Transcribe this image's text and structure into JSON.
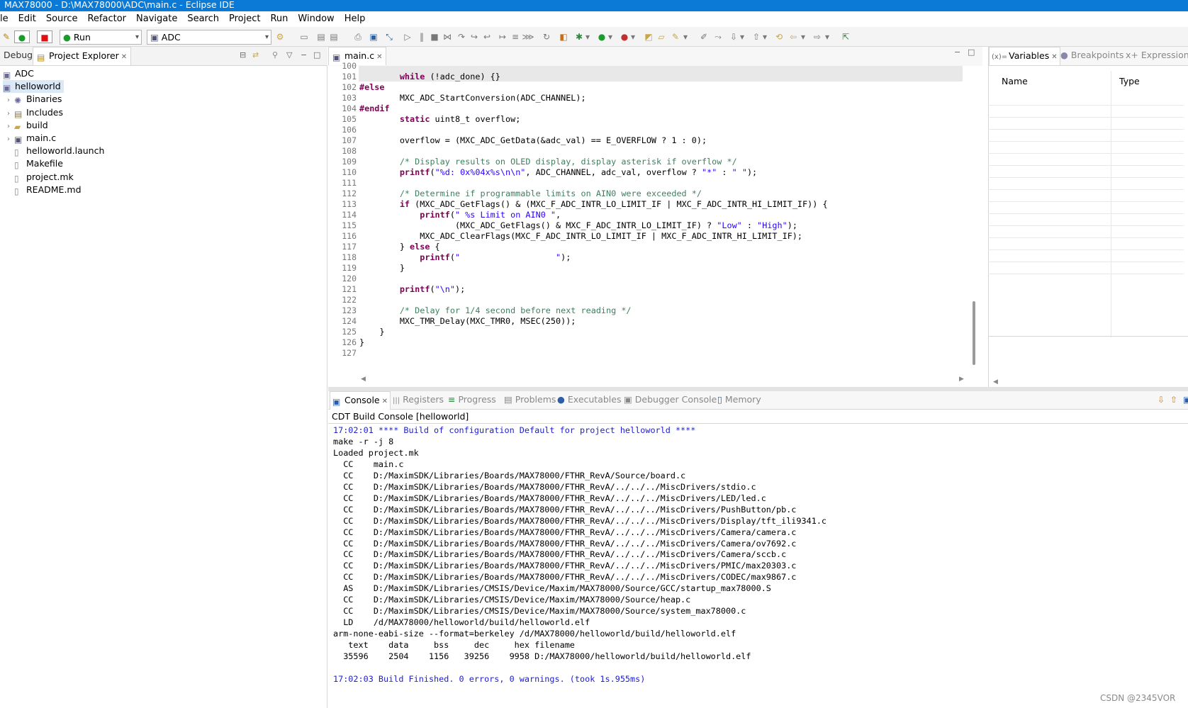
{
  "window": {
    "title": "MAX78000 - D:\\MAX78000\\ADC\\main.c - Eclipse IDE"
  },
  "menu": [
    "le",
    "Edit",
    "Source",
    "Refactor",
    "Navigate",
    "Search",
    "Project",
    "Run",
    "Window",
    "Help"
  ],
  "toolbar": {
    "run_config": "Run",
    "project_combo": "ADC"
  },
  "left_panel": {
    "tabs": [
      "Debug",
      "Project Explorer"
    ],
    "tree": [
      {
        "label": "ADC",
        "depth": 0,
        "expandable": false,
        "selected": false,
        "icon": "project-icon"
      },
      {
        "label": "helloworld",
        "depth": 0,
        "expandable": false,
        "selected": true,
        "icon": "project-icon"
      },
      {
        "label": "Binaries",
        "depth": 1,
        "expandable": true,
        "selected": false,
        "icon": "binaries-icon"
      },
      {
        "label": "Includes",
        "depth": 1,
        "expandable": true,
        "selected": false,
        "icon": "includes-icon"
      },
      {
        "label": "build",
        "depth": 1,
        "expandable": true,
        "selected": false,
        "icon": "folder-icon"
      },
      {
        "label": "main.c",
        "depth": 1,
        "expandable": true,
        "selected": false,
        "icon": "c-file-icon"
      },
      {
        "label": "helloworld.launch",
        "depth": 1,
        "expandable": false,
        "selected": false,
        "icon": "file-icon"
      },
      {
        "label": "Makefile",
        "depth": 1,
        "expandable": false,
        "selected": false,
        "icon": "file-icon"
      },
      {
        "label": "project.mk",
        "depth": 1,
        "expandable": false,
        "selected": false,
        "icon": "file-icon"
      },
      {
        "label": "README.md",
        "depth": 1,
        "expandable": false,
        "selected": false,
        "icon": "file-icon"
      }
    ]
  },
  "editor": {
    "tab": "main.c",
    "lines": [
      {
        "n": "100",
        "t": []
      },
      {
        "n": "101",
        "t": [
          [
            "",
            "        "
          ],
          [
            "kw",
            "while"
          ],
          [
            "",
            " (!adc_done) {}"
          ]
        ],
        "hl": true
      },
      {
        "n": "102",
        "t": [
          [
            "pp",
            "#else"
          ]
        ]
      },
      {
        "n": "103",
        "t": [
          [
            "",
            "        MXC_ADC_StartConversion(ADC_CHANNEL);"
          ]
        ]
      },
      {
        "n": "104",
        "t": [
          [
            "pp",
            "#endif"
          ]
        ]
      },
      {
        "n": "105",
        "t": [
          [
            "",
            "        "
          ],
          [
            "kw",
            "static"
          ],
          [
            "",
            " uint8_t overflow;"
          ]
        ]
      },
      {
        "n": "106",
        "t": []
      },
      {
        "n": "107",
        "t": [
          [
            "",
            "        overflow = (MXC_ADC_GetData(&adc_val) == E_OVERFLOW ? 1 : 0);"
          ]
        ]
      },
      {
        "n": "108",
        "t": []
      },
      {
        "n": "109",
        "t": [
          [
            "",
            "        "
          ],
          [
            "cm",
            "/* Display results on OLED display, display asterisk if overflow */"
          ]
        ]
      },
      {
        "n": "110",
        "t": [
          [
            "",
            "        "
          ],
          [
            "kw",
            "printf"
          ],
          [
            "",
            "("
          ],
          [
            "st",
            "\"%d: 0x%04x%s\\n\\n\""
          ],
          [
            "",
            ", ADC_CHANNEL, adc_val, overflow ? "
          ],
          [
            "st",
            "\"*\""
          ],
          [
            "",
            " : "
          ],
          [
            "st",
            "\" \""
          ],
          [
            "",
            ");"
          ]
        ]
      },
      {
        "n": "111",
        "t": []
      },
      {
        "n": "112",
        "t": [
          [
            "",
            "        "
          ],
          [
            "cm",
            "/* Determine if programmable limits on AIN0 were exceeded */"
          ]
        ]
      },
      {
        "n": "113",
        "t": [
          [
            "",
            "        "
          ],
          [
            "kw",
            "if"
          ],
          [
            "",
            " (MXC_ADC_GetFlags() & (MXC_F_ADC_INTR_LO_LIMIT_IF | MXC_F_ADC_INTR_HI_LIMIT_IF)) {"
          ]
        ]
      },
      {
        "n": "114",
        "t": [
          [
            "",
            "            "
          ],
          [
            "kw",
            "printf"
          ],
          [
            "",
            "("
          ],
          [
            "st",
            "\" %s Limit on AIN0 \""
          ],
          [
            "",
            ","
          ]
        ]
      },
      {
        "n": "115",
        "t": [
          [
            "",
            "                   (MXC_ADC_GetFlags() & MXC_F_ADC_INTR_LO_LIMIT_IF) ? "
          ],
          [
            "st",
            "\"Low\""
          ],
          [
            "",
            " : "
          ],
          [
            "st",
            "\"High\""
          ],
          [
            "",
            ");"
          ]
        ]
      },
      {
        "n": "116",
        "t": [
          [
            "",
            "            MXC_ADC_ClearFlags(MXC_F_ADC_INTR_LO_LIMIT_IF | MXC_F_ADC_INTR_HI_LIMIT_IF);"
          ]
        ]
      },
      {
        "n": "117",
        "t": [
          [
            "",
            "        } "
          ],
          [
            "kw",
            "else"
          ],
          [
            "",
            " {"
          ]
        ]
      },
      {
        "n": "118",
        "t": [
          [
            "",
            "            "
          ],
          [
            "kw",
            "printf"
          ],
          [
            "",
            "("
          ],
          [
            "st",
            "\"                   \""
          ],
          [
            "",
            ");"
          ]
        ]
      },
      {
        "n": "119",
        "t": [
          [
            "",
            "        }"
          ]
        ]
      },
      {
        "n": "120",
        "t": []
      },
      {
        "n": "121",
        "t": [
          [
            "",
            "        "
          ],
          [
            "kw",
            "printf"
          ],
          [
            "",
            "("
          ],
          [
            "st",
            "\"\\n\""
          ],
          [
            "",
            ");"
          ]
        ]
      },
      {
        "n": "122",
        "t": []
      },
      {
        "n": "123",
        "t": [
          [
            "",
            "        "
          ],
          [
            "cm",
            "/* Delay for 1/4 second before next reading */"
          ]
        ]
      },
      {
        "n": "124",
        "t": [
          [
            "",
            "        MXC_TMR_Delay(MXC_TMR0, MSEC(250));"
          ]
        ]
      },
      {
        "n": "125",
        "t": [
          [
            "",
            "    }"
          ]
        ]
      },
      {
        "n": "126",
        "t": [
          [
            "",
            "}"
          ]
        ]
      },
      {
        "n": "127",
        "t": []
      }
    ]
  },
  "right_panel": {
    "tabs": [
      "Variables",
      "Breakpoints",
      "Expressions"
    ],
    "columns": [
      "Name",
      "Type"
    ]
  },
  "console": {
    "tabs": [
      "Console",
      "Registers",
      "Progress",
      "Problems",
      "Executables",
      "Debugger Console",
      "Memory"
    ],
    "title": "CDT Build Console [helloworld]",
    "lines": [
      {
        "c": "blue",
        "t": "17:02:01 **** Build of configuration Default for project helloworld ****"
      },
      {
        "c": "",
        "t": "make -r -j 8"
      },
      {
        "c": "",
        "t": "Loaded project.mk"
      },
      {
        "c": "",
        "t": "  CC    main.c"
      },
      {
        "c": "",
        "t": "  CC    D:/MaximSDK/Libraries/Boards/MAX78000/FTHR_RevA/Source/board.c"
      },
      {
        "c": "",
        "t": "  CC    D:/MaximSDK/Libraries/Boards/MAX78000/FTHR_RevA/../../../MiscDrivers/stdio.c"
      },
      {
        "c": "",
        "t": "  CC    D:/MaximSDK/Libraries/Boards/MAX78000/FTHR_RevA/../../../MiscDrivers/LED/led.c"
      },
      {
        "c": "",
        "t": "  CC    D:/MaximSDK/Libraries/Boards/MAX78000/FTHR_RevA/../../../MiscDrivers/PushButton/pb.c"
      },
      {
        "c": "",
        "t": "  CC    D:/MaximSDK/Libraries/Boards/MAX78000/FTHR_RevA/../../../MiscDrivers/Display/tft_ili9341.c"
      },
      {
        "c": "",
        "t": "  CC    D:/MaximSDK/Libraries/Boards/MAX78000/FTHR_RevA/../../../MiscDrivers/Camera/camera.c"
      },
      {
        "c": "",
        "t": "  CC    D:/MaximSDK/Libraries/Boards/MAX78000/FTHR_RevA/../../../MiscDrivers/Camera/ov7692.c"
      },
      {
        "c": "",
        "t": "  CC    D:/MaximSDK/Libraries/Boards/MAX78000/FTHR_RevA/../../../MiscDrivers/Camera/sccb.c"
      },
      {
        "c": "",
        "t": "  CC    D:/MaximSDK/Libraries/Boards/MAX78000/FTHR_RevA/../../../MiscDrivers/PMIC/max20303.c"
      },
      {
        "c": "",
        "t": "  CC    D:/MaximSDK/Libraries/Boards/MAX78000/FTHR_RevA/../../../MiscDrivers/CODEC/max9867.c"
      },
      {
        "c": "",
        "t": "  AS    D:/MaximSDK/Libraries/CMSIS/Device/Maxim/MAX78000/Source/GCC/startup_max78000.S"
      },
      {
        "c": "",
        "t": "  CC    D:/MaximSDK/Libraries/CMSIS/Device/Maxim/MAX78000/Source/heap.c"
      },
      {
        "c": "",
        "t": "  CC    D:/MaximSDK/Libraries/CMSIS/Device/Maxim/MAX78000/Source/system_max78000.c"
      },
      {
        "c": "",
        "t": "  LD    /d/MAX78000/helloworld/build/helloworld.elf"
      },
      {
        "c": "",
        "t": "arm-none-eabi-size --format=berkeley /d/MAX78000/helloworld/build/helloworld.elf"
      },
      {
        "c": "",
        "t": "   text    data     bss     dec     hex filename"
      },
      {
        "c": "",
        "t": "  35596    2504    1156   39256    9958 D:/MAX78000/helloworld/build/helloworld.elf"
      },
      {
        "c": "",
        "t": ""
      },
      {
        "c": "blue",
        "t": "17:02:03 Build Finished. 0 errors, 0 warnings. (took 1s.955ms)"
      }
    ]
  },
  "watermark": "CSDN @2345VOR"
}
